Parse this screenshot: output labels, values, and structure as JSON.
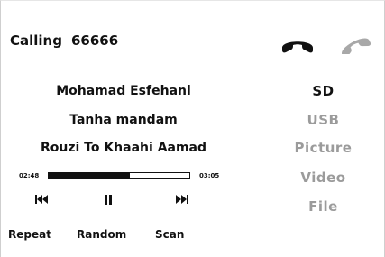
{
  "call": {
    "status": "Calling",
    "number": "66666"
  },
  "icons": {
    "answer": "phone-handset-icon",
    "hangup": "phone-handset-icon"
  },
  "colors": {
    "text": "#111111",
    "inactive": "#9b9b9b",
    "handset_active": "#111111",
    "handset_inactive": "#a8a8a8"
  },
  "track": {
    "artist": "Mohamad Esfehani",
    "album": "Tanha mandam",
    "title": "Rouzi To Khaahi Aamad"
  },
  "progress": {
    "elapsed": "02:48",
    "total": "03:05",
    "fraction": 0.576
  },
  "controls": {
    "prev_icon": "skip-previous-icon",
    "pause_icon": "pause-icon",
    "next_icon": "skip-next-icon"
  },
  "modes": {
    "repeat": "Repeat",
    "random": "Random",
    "scan": "Scan"
  },
  "sources": [
    {
      "label": "SD",
      "active": true
    },
    {
      "label": "USB",
      "active": false
    },
    {
      "label": "Picture",
      "active": false
    },
    {
      "label": "Video",
      "active": false
    },
    {
      "label": "File",
      "active": false
    }
  ]
}
